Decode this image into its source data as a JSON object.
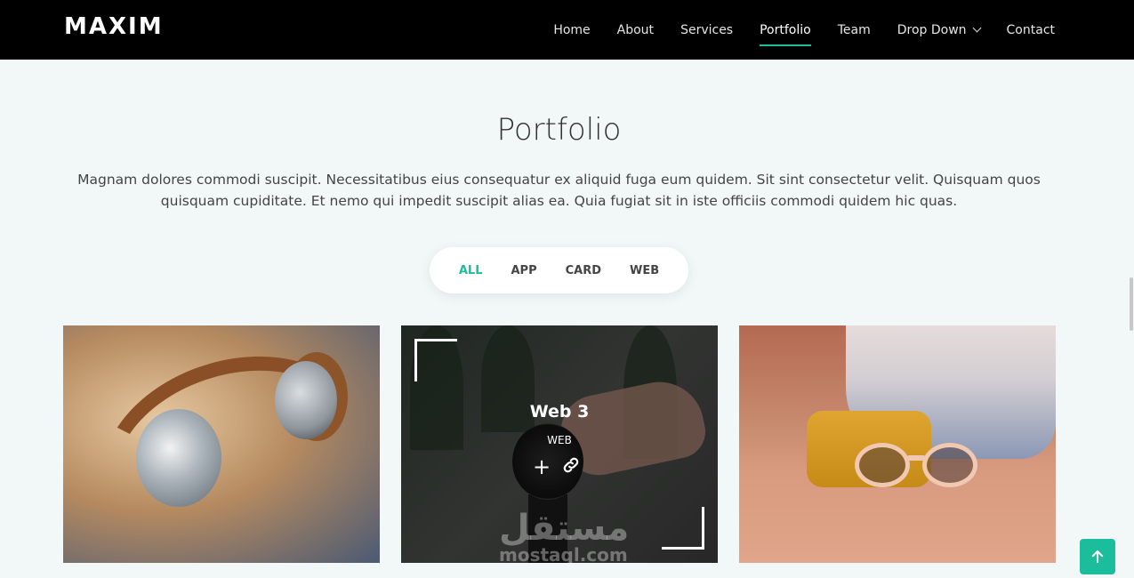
{
  "brand": {
    "logo": "MAXIM"
  },
  "nav": {
    "items": [
      {
        "label": "Home"
      },
      {
        "label": "About"
      },
      {
        "label": "Services"
      },
      {
        "label": "Portfolio"
      },
      {
        "label": "Team"
      },
      {
        "label": "Drop Down"
      },
      {
        "label": "Contact"
      }
    ],
    "active": "Portfolio",
    "accent_color": "#1bbd9c"
  },
  "section": {
    "title": "Portfolio",
    "description": "Magnam dolores commodi suscipit. Necessitatibus eius consequatur ex aliquid fuga eum quidem. Sit sint consectetur velit. Quisquam quos quisquam cupiditate. Et nemo qui impedit suscipit alias ea. Quia fugiat sit in iste officiis commodi quidem hic quas."
  },
  "filters": {
    "items": [
      {
        "label": "ALL"
      },
      {
        "label": "APP"
      },
      {
        "label": "CARD"
      },
      {
        "label": "WEB"
      }
    ],
    "active": "ALL"
  },
  "portfolio": {
    "items": [
      {
        "image": "headphones"
      },
      {
        "image": "wristwatch",
        "title": "Web 3",
        "category": "WEB",
        "icons": [
          "plus-icon",
          "link-icon"
        ]
      },
      {
        "image": "sunglasses"
      }
    ]
  },
  "watermark": {
    "text": "مستقل",
    "sub": "mostaql.com"
  },
  "back_to_top": {
    "icon": "arrow-up-icon"
  }
}
